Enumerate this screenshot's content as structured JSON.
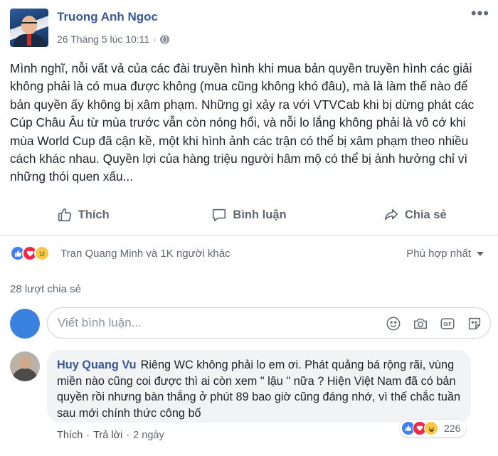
{
  "post": {
    "author": "Truong Anh Ngoc",
    "timestamp": "26 Tháng 5 lúc 10:11",
    "meta_separator": "·",
    "privacy_icon": "globe-icon",
    "more_label": "•••",
    "text": "Mình nghĩ, nỗi vất vả của các đài truyền hình khi mua bản quyền truyền hình các giải không phải là có mua được không (mua cũng không khó đâu), mà là làm thế nào để bản quyền ấy không bị xâm phạm. Những gì xảy ra với VTVCab khi bị dừng phát các Cúp Châu Âu từ mùa trước vẫn còn nóng hổi, và nỗi lo lắng không phải là vô cớ khi mùa World Cup đã cận kề, một khi hình ảnh các trận có thể bị xâm phạm theo nhiều cách khác nhau. Quyền lợi của hàng triệu người hâm mộ có thể bị ảnh hưởng chỉ vì những thói quen xấu..."
  },
  "actions": {
    "like": "Thích",
    "comment": "Bình luận",
    "share": "Chia sẻ"
  },
  "reactions": {
    "icons": [
      "like-reaction-icon",
      "love-reaction-icon",
      "sad-reaction-icon"
    ],
    "summary": "Tran Quang Minh và 1K người khác",
    "sort_label": "Phù hợp nhất"
  },
  "shares_label": "28 lượt chia sẻ",
  "composer": {
    "placeholder": "Viết bình luận...",
    "icons": [
      "emoji-icon",
      "camera-icon",
      "gif-icon",
      "sticker-icon"
    ]
  },
  "comment": {
    "author": "Huy Quang Vu",
    "text": "Riêng WC không phải lo em ơi. Phát quảng bá rộng rãi, vùng miền nào cũng coi được thì ai còn xem \" lậu \" nữa ? Hiện Việt Nam đã có bản quyền rồi nhưng bàn thắng ở phút 89 bao giờ cũng đáng nhớ, vì thế chắc tuần sau mới chính thức công bố",
    "reaction_count": "226",
    "like_link": "Thích",
    "reply_link": "Trả lời",
    "age": "2 ngày",
    "separator": "·"
  },
  "colors": {
    "link_blue": "#385898",
    "secondary_text": "#606770",
    "like_blue": "#3f7ff2",
    "love_red": "#f0284a",
    "emoji_yellow": "#f7c945",
    "bubble_bg": "#f2f3f5"
  }
}
